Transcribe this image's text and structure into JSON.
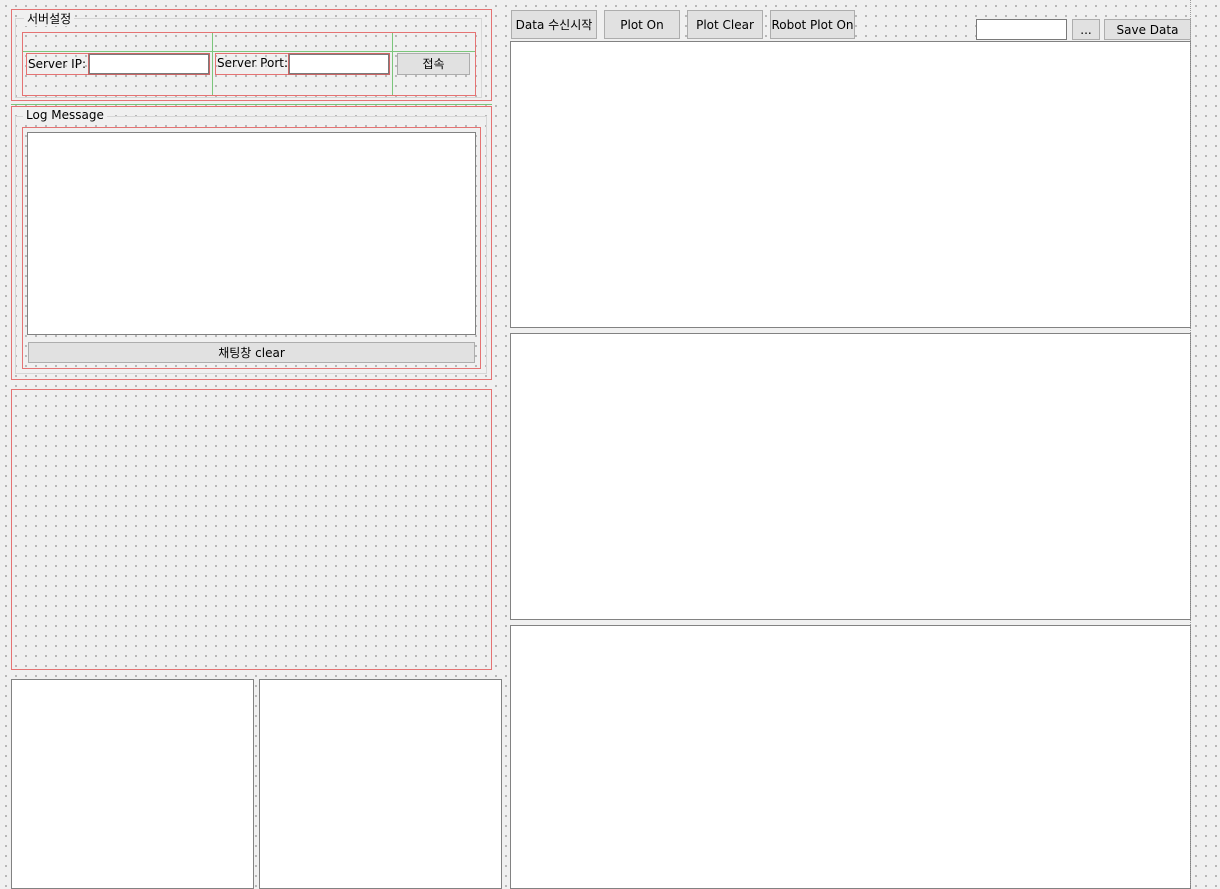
{
  "server_group": {
    "title": "서버설정",
    "server_ip_label": "Server IP:",
    "server_ip_value": "",
    "server_port_label": "Server Port:",
    "server_port_value": "",
    "connect_label": "접속"
  },
  "log_group": {
    "title": "Log Message",
    "log_text": "",
    "clear_label": "채팅창 clear"
  },
  "toolbar": {
    "data_receive_label": "Data 수신시작",
    "plot_on_label": "Plot On",
    "plot_clear_label": "Plot Clear",
    "robot_plot_on_label": "Robot Plot On",
    "file_path_value": "",
    "browse_label": "...",
    "save_data_label": "Save Data"
  }
}
